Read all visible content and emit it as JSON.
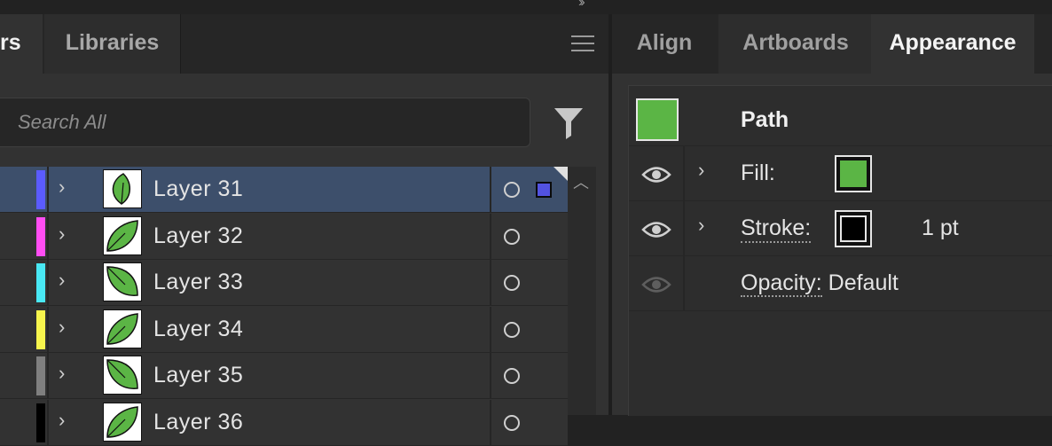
{
  "left_panel": {
    "tabs": {
      "layers_partial": "rs",
      "libraries": "Libraries"
    },
    "menu_icon": "hamburger-icon",
    "search": {
      "placeholder": "Search All",
      "value": ""
    },
    "filter_icon": "funnel-icon",
    "layers": [
      {
        "name": "Layer 31",
        "color": "#5b5bff",
        "selected": true
      },
      {
        "name": "Layer 32",
        "color": "#ff4df2"
      },
      {
        "name": "Layer 33",
        "color": "#49e8f4"
      },
      {
        "name": "Layer 34",
        "color": "#f7f54d"
      },
      {
        "name": "Layer 35",
        "color": "#7f7f7f"
      },
      {
        "name": "Layer 36",
        "color": "#000000"
      }
    ],
    "thumbnail_icon": "leaf-icon",
    "target_icon": "circle-target-icon",
    "selection_color": "#5252e0"
  },
  "right_panel": {
    "tabs": {
      "align": "Align",
      "artboards": "Artboards",
      "appearance": "Appearance"
    },
    "active_tab": "Appearance",
    "appearance": {
      "object_label": "Path",
      "object_color": "#5bb545",
      "fill": {
        "label": "Fill:",
        "color": "#5bb545"
      },
      "stroke": {
        "label": "Stroke:",
        "color": "#000000",
        "value": "1 pt"
      },
      "opacity": {
        "label": "Opacity:",
        "value": "Default"
      }
    }
  }
}
